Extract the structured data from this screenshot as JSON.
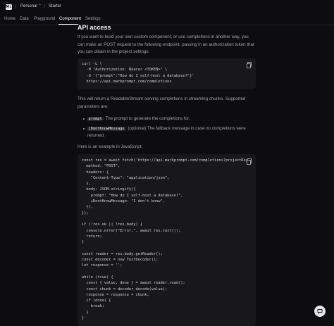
{
  "topbar": {
    "logo": "M↓",
    "workspace": "Personal",
    "workspace_chevron": "⌃",
    "plan": "Starter"
  },
  "tabs": [
    "Home",
    "Data",
    "Playground",
    "Component",
    "Settings"
  ],
  "active_tab": "Component",
  "section": {
    "title": "API access",
    "intro": "If you want to build your own custom component, or use completions in another way, you can make an POST request to the following endpoint, passing in an authorization token that you can obtain in the project settings:",
    "curl_code": "curl -L \\\n  -H \"Authorization: Bearer <TOKEN>\" \\\n  -d '{\"prompt\":\"How do I self-host a database?\"}'\n  https://api.markprompt.com/completions",
    "stream_text": "This will return a ReadableStream serving completions in streaming chunks. Supported parameters are:",
    "params": [
      {
        "name": "prompt",
        "desc": ": The prompt to generate the completions for."
      },
      {
        "name": "iDontKnowMessage",
        "desc": ": (optional) The fallback message in case no completions were returned."
      }
    ],
    "js_intro": "Here is an example in JavaScript:",
    "js_code": "const res = await fetch('https://api.markprompt.com/completions?projectKey=<\n  method: \"POST\",\n  headers: {\n    \"Content-Type\": \"application/json\",\n  },\n  body: JSON.stringify({\n    prompt: \"How do I self-host a database?\",\n    iDontKnowMessage: \"I don't know\",\n  }),\n});\n\nif (!res.ok || !res.body) {\n  console.error(\"Error:\", await res.text());\n  return;\n}\n\nconst reader = res.body.getReader();\nconst decoder = new TextDecoder();\nlet response = '';\n\nwhile (true) {\n  const { value, done } = await reader.read();\n  const chunk = decoder.decode(value);\n  response = response + chunk;\n  if (done) {\n    break;\n  }\n}"
  },
  "colors": {
    "background": "#0d0d0f",
    "code_bg": "#18181b",
    "text": "#a1a1aa",
    "active": "#ffffff"
  },
  "icons": [
    "logo-icon",
    "chevron-updown-icon",
    "copy-icon",
    "chat-icon"
  ]
}
